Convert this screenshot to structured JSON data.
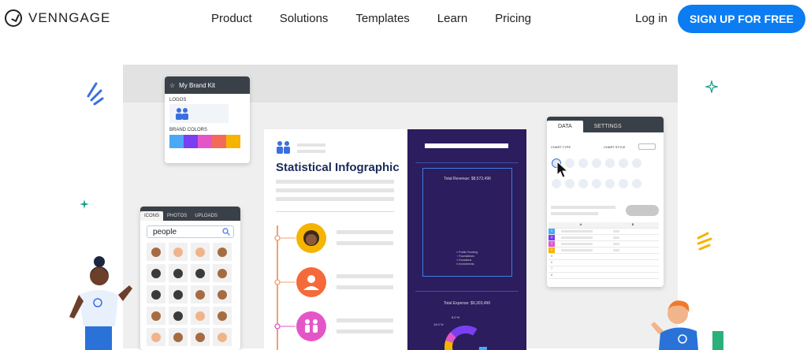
{
  "header": {
    "brand": "VENNGAGE",
    "nav": [
      "Product",
      "Solutions",
      "Templates",
      "Learn",
      "Pricing"
    ],
    "login": "Log in",
    "signup": "SIGN UP FOR FREE"
  },
  "brand_kit": {
    "title": "My Brand Kit",
    "logos_label": "LOGOS",
    "colors_label": "BRAND COLORS",
    "colors": [
      "#4aa8f5",
      "#7a3ff0",
      "#e456c8",
      "#f46a5a",
      "#f5b400"
    ]
  },
  "icons_panel": {
    "tabs": [
      "ICONS",
      "PHOTOS",
      "UPLOADS"
    ],
    "search_value": "people"
  },
  "infographic": {
    "title": "Statistical Infographic",
    "revenue": "Total Revenue: $8,572,496",
    "expense": "Total Expense: $9,303,496",
    "pct_a": "5.0 %",
    "pct_b": "14.0 %",
    "legend": [
      "Public Funding",
      "Foundations",
      "Donations",
      "Investments"
    ]
  },
  "data_panel": {
    "tabs": [
      "DATA",
      "SETTINGS"
    ],
    "chart_type": "CHART TYPE",
    "chart_style": "CHART STYLE",
    "col_a": "A",
    "col_b": "B",
    "rows": [
      "1",
      "2",
      "3",
      "4",
      "5",
      "6",
      "7",
      "8"
    ]
  },
  "colors": {
    "accent": "#0c7cf2",
    "dark_panel": "#2b1d5e",
    "title_navy": "#1a2a5a"
  }
}
